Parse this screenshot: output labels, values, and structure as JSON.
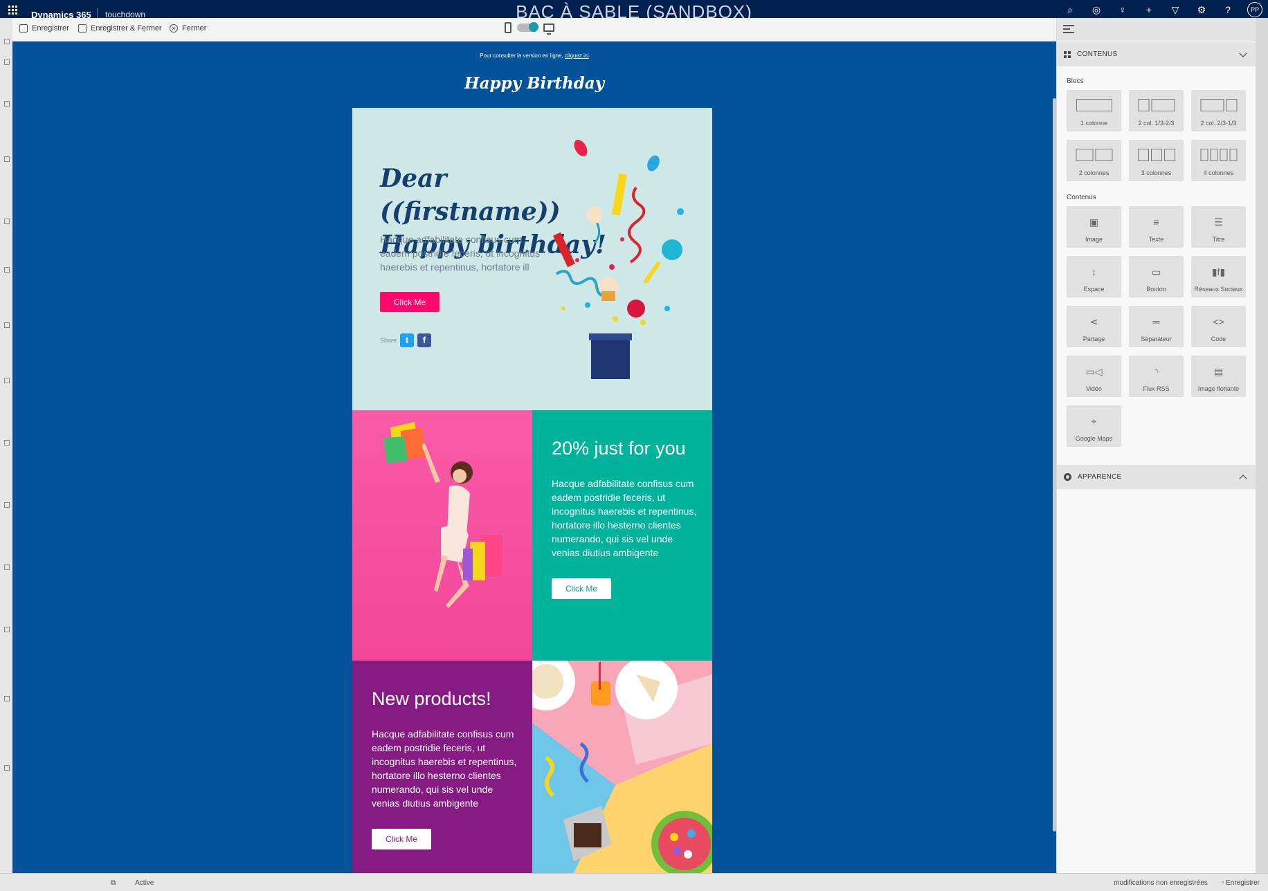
{
  "topbar": {
    "app_name": "Dynamics 365",
    "org_name": "touchdown",
    "env_title": "BAC À SABLE (SANDBOX)",
    "icons": [
      "search-icon",
      "task-icon",
      "idea-icon",
      "add-icon",
      "filter-icon",
      "settings-icon",
      "help-icon"
    ],
    "avatar_initials": "PP"
  },
  "toolbar": {
    "save_label": "Enregistrer",
    "save_close_label": "Enregistrer & Fermer",
    "close_label": "Fermer"
  },
  "email": {
    "preheader_text": "Pour consulter la version en ligne,",
    "preheader_link": "cliquez ici",
    "brand_title": "Happy Birthday",
    "hero": {
      "greeting_line1": "Dear ((firstname))",
      "greeting_line2": "Happy birthday!",
      "body": "Hacque adfabilitate confisus cum eadem postridie feceris, ut incognitus haerebis et repentinus, hortatore ill",
      "button": "Click Me",
      "share_label": "Share"
    },
    "promo1": {
      "title": "20% just for you",
      "body": "Hacque adfabilitate confisus cum eadem postridie feceris, ut incognitus haerebis et repentinus, hortatore illo hesterno clientes numerando, qui sis vel unde venias diutius ambigente",
      "button": "Click Me"
    },
    "promo2": {
      "title": "New products!",
      "body": "Hacque adfabilitate confisus cum eadem postridie feceris, ut incognitus haerebis et repentinus, hortatore illo hesterno clientes numerando, qui sis vel unde venias diutius ambigente",
      "button": "Click Me"
    },
    "colors": {
      "canvas": "#045299",
      "hero_bg": "#cde8e6",
      "pink_button": "#ff0a6c",
      "teal": "#00b39a",
      "purple": "#861a83",
      "heading_navy": "#163f70"
    }
  },
  "panel": {
    "content_section": "CONTENUS",
    "blocks_label": "Blocs",
    "blocks": [
      "1 colonne",
      "2 col. 1/3-2/3",
      "2 col. 2/3-1/3",
      "2 colonnes",
      "3 colonnes",
      "4 colonnes"
    ],
    "contents_label": "Contenus",
    "contents": [
      "Image",
      "Texte",
      "Titre",
      "Espace",
      "Bouton",
      "Réseaux Sociaux",
      "Partage",
      "Séparateur",
      "Code",
      "Vidéo",
      "Flux RSS",
      "Image flottante",
      "Google Maps"
    ],
    "appearance_section": "APPARENCE"
  },
  "statusbar": {
    "record_status": "Active",
    "unsaved_text": "modifications non enregistrées",
    "save_label": "Enregistrer"
  }
}
